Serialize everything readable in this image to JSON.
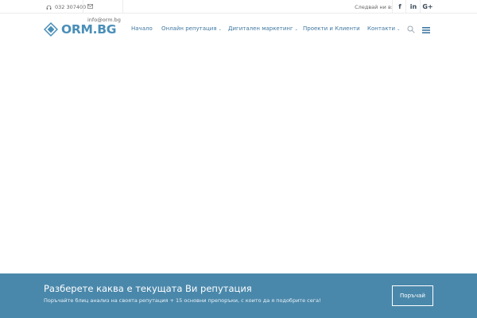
{
  "topbar": {
    "phone": "032 307400",
    "email": "info@orm.bg",
    "follow_label": "Следвай ни в:",
    "social": {
      "facebook": "f",
      "linkedin": "in",
      "googleplus": "G+"
    }
  },
  "header": {
    "logo_text": "ORM.BG",
    "nav": [
      {
        "label": "Начало",
        "has_dropdown": false
      },
      {
        "label": "Онлайн репутация",
        "has_dropdown": true
      },
      {
        "label": "Дигитален маркетинг",
        "has_dropdown": true
      },
      {
        "label": "Проекти и Клиенти",
        "has_dropdown": false
      },
      {
        "label": "Контакти",
        "has_dropdown": true
      }
    ],
    "caret": "⌄",
    "search_icon": "search-icon",
    "menu_icon": "hamburger-menu-icon"
  },
  "cta": {
    "title": "Разберете каква е текущата Ви репутация",
    "subtitle": "Поръчайте блиц анализ на своята репутация + 15 основни препоръки, с които да я подобрите сега!",
    "button_label": "Поръчай"
  },
  "colors": {
    "brand": "#4a8fb8",
    "nav_text": "#3f77a0",
    "cta_bg": "#4a88ab"
  }
}
